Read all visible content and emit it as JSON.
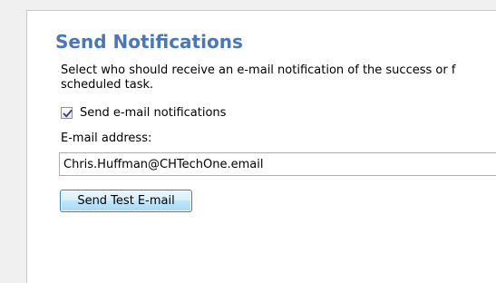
{
  "section": {
    "title": "Send Notifications",
    "description_line1": "Select who should receive an e-mail notification of the success or f",
    "description_line2": "scheduled task."
  },
  "notifications": {
    "checkbox_label": "Send e-mail notifications",
    "checked": true
  },
  "email": {
    "label": "E-mail address:",
    "value": "Chris.Huffman@CHTechOne.email"
  },
  "buttons": {
    "send_test_label": "Send Test E-mail"
  },
  "colors": {
    "heading": "#4a76ba",
    "background": "#f0f0f0",
    "panel": "#ffffff"
  }
}
